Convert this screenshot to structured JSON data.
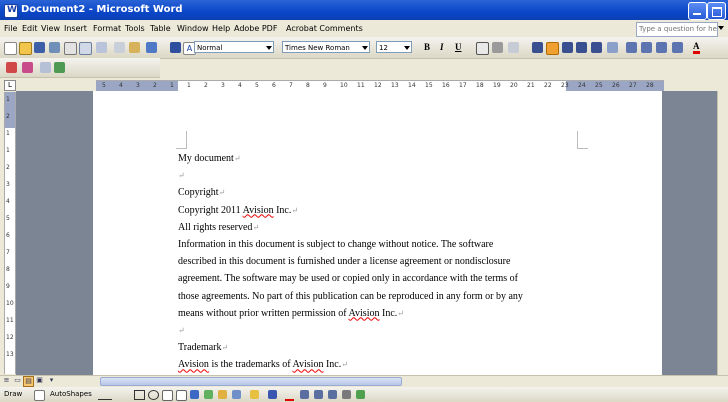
{
  "window": {
    "title": "Document2 - Microsoft Word"
  },
  "menu": {
    "items": [
      "File",
      "Edit",
      "View",
      "Insert",
      "Format",
      "Tools",
      "Table",
      "Window",
      "Help",
      "Adobe PDF",
      "Acrobat Comments"
    ],
    "help_placeholder": "Type a question for help"
  },
  "toolbar": {
    "style_value": "Normal",
    "font_value": "Times New Roman",
    "size_value": "12",
    "bold_label": "B",
    "italic_label": "I",
    "underline_label": "U",
    "font_color_label": "A"
  },
  "ruler": {
    "h_labels": [
      "5",
      "4",
      "3",
      "2",
      "1",
      "1",
      "2",
      "3",
      "4",
      "5",
      "6",
      "7",
      "8",
      "9",
      "10",
      "11",
      "12",
      "13",
      "14",
      "15",
      "16",
      "17",
      "18",
      "19",
      "20",
      "21",
      "22",
      "23",
      "24",
      "25",
      "26",
      "27",
      "28"
    ],
    "v_labels": [
      "1",
      "2",
      "1",
      "1",
      "2",
      "3",
      "4",
      "5",
      "6",
      "7",
      "8",
      "9",
      "10",
      "11",
      "12",
      "13"
    ]
  },
  "document": {
    "lines": [
      "My document",
      "",
      "Copyright",
      "Copyright 2011 Avision Inc.",
      "All rights reserved",
      "Information in this document is subject to change without notice. The software",
      "described in this document is furnished under a license agreement or nondisclosure",
      "agreement. The software may be used or copied only in accordance with the terms of",
      "those agreements. No part of this publication can be reproduced in any form or by any",
      "means without prior written permission of Avision Inc.",
      "",
      "Trademark",
      "Avision is the trademarks of Avision Inc."
    ],
    "paragraph_mark": "↵"
  },
  "drawbar": {
    "draw_label": "Draw",
    "autoshapes_label": "AutoShapes"
  },
  "colors": {
    "titlebar": "#0a46c8",
    "workspace": "#7b8593",
    "spelling_squiggle": "#e00000"
  }
}
